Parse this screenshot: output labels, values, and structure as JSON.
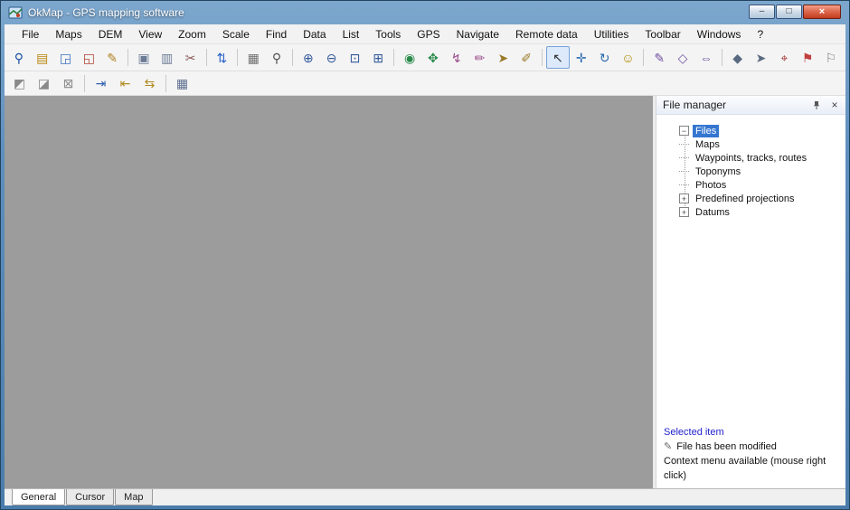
{
  "window": {
    "title": "OkMap - GPS mapping software",
    "controls": {
      "minimize": "–",
      "maximize": "□",
      "close": "×"
    }
  },
  "menu": {
    "items": [
      "File",
      "Maps",
      "DEM",
      "View",
      "Zoom",
      "Scale",
      "Find",
      "Data",
      "List",
      "Tools",
      "GPS",
      "Navigate",
      "Remote data",
      "Utilities",
      "Toolbar",
      "Windows",
      "?"
    ]
  },
  "toolbars": {
    "main": {
      "groups": [
        [
          {
            "name": "zoom-select-icon",
            "glyph": "⚲",
            "color": "#1a50a0"
          },
          {
            "name": "open-map-icon",
            "glyph": "▤",
            "color": "#b8860b"
          },
          {
            "name": "import-map-icon",
            "glyph": "◲",
            "color": "#3a70c0"
          },
          {
            "name": "close-map-icon",
            "glyph": "◱",
            "color": "#b04030"
          },
          {
            "name": "save-map-icon",
            "glyph": "✎",
            "color": "#b08020"
          }
        ],
        [
          {
            "name": "copy-map-icon",
            "glyph": "▣",
            "color": "#6b7b95"
          },
          {
            "name": "duplicate-map-icon",
            "glyph": "▥",
            "color": "#6b7b95"
          },
          {
            "name": "crop-map-icon",
            "glyph": "✂",
            "color": "#8a5a5a"
          }
        ],
        [
          {
            "name": "send-remote-icon",
            "glyph": "⇅",
            "color": "#2a62c8"
          }
        ],
        [
          {
            "name": "map-properties-icon",
            "glyph": "▦",
            "color": "#707070"
          },
          {
            "name": "find-icon",
            "glyph": "⚲",
            "color": "#505050"
          }
        ],
        [
          {
            "name": "zoom-in-icon",
            "glyph": "⊕",
            "color": "#33589a"
          },
          {
            "name": "zoom-out-icon",
            "glyph": "⊖",
            "color": "#33589a"
          },
          {
            "name": "zoom-window-icon",
            "glyph": "⊡",
            "color": "#33589a"
          },
          {
            "name": "zoom-actual-icon",
            "glyph": "⊞",
            "color": "#33589a"
          }
        ],
        [
          {
            "name": "waypoint-new-icon",
            "glyph": "◉",
            "color": "#2a8a4a"
          },
          {
            "name": "waypoint-move-icon",
            "glyph": "✥",
            "color": "#2a8a4a"
          },
          {
            "name": "track-new-icon",
            "glyph": "↯",
            "color": "#9a4a8a"
          },
          {
            "name": "track-edit-icon",
            "glyph": "✏",
            "color": "#9a4a8a"
          },
          {
            "name": "route-new-icon",
            "glyph": "➤",
            "color": "#9a7a2a"
          },
          {
            "name": "route-edit-icon",
            "glyph": "✐",
            "color": "#9a7a2a"
          }
        ],
        [
          {
            "name": "pointer-icon",
            "glyph": "↖",
            "color": "#303030",
            "selected": true
          },
          {
            "name": "pan-icon",
            "glyph": "✛",
            "color": "#2a6ab0"
          },
          {
            "name": "rotate-icon",
            "glyph": "↻",
            "color": "#2a6ab0"
          },
          {
            "name": "smiley-icon",
            "glyph": "☺",
            "color": "#b08a00"
          }
        ],
        [
          {
            "name": "draw-line-icon",
            "glyph": "✎",
            "color": "#7050a0"
          },
          {
            "name": "draw-polygon-icon",
            "glyph": "◇",
            "color": "#7050a0"
          },
          {
            "name": "measure-icon",
            "glyph": "⇔",
            "color": "#7050a0"
          }
        ],
        [
          {
            "name": "vertex-icon",
            "glyph": "◆",
            "color": "#5a6a80"
          },
          {
            "name": "goto-icon",
            "glyph": "➤",
            "color": "#5a6a80"
          },
          {
            "name": "pin-add-icon",
            "glyph": "⌖",
            "color": "#a03030"
          },
          {
            "name": "flag-icon",
            "glyph": "⚑",
            "color": "#c04040"
          },
          {
            "name": "pin-delete-icon",
            "glyph": "⚐",
            "color": "#808080"
          }
        ]
      ]
    },
    "edit": {
      "groups": [
        [
          {
            "name": "eraser-icon",
            "glyph": "◩",
            "color": "#8a8a8a"
          },
          {
            "name": "eraser-region-icon",
            "glyph": "◪",
            "color": "#8a8a8a"
          },
          {
            "name": "eraser-all-icon",
            "glyph": "⊠",
            "color": "#8a8a8a"
          }
        ],
        [
          {
            "name": "import-data-icon",
            "glyph": "⇥",
            "color": "#3060b0"
          },
          {
            "name": "export-data-icon",
            "glyph": "⇤",
            "color": "#b08a20"
          },
          {
            "name": "merge-data-icon",
            "glyph": "⇆",
            "color": "#b08a20"
          }
        ],
        [
          {
            "name": "data-properties-icon",
            "glyph": "▦",
            "color": "#607090"
          }
        ]
      ]
    }
  },
  "file_manager": {
    "title": "File manager",
    "close_glyph": "×",
    "tree": {
      "root": {
        "label": "Files",
        "selected": true,
        "expander": "−"
      },
      "children": [
        {
          "label": "Maps"
        },
        {
          "label": "Waypoints, tracks, routes"
        },
        {
          "label": "Toponyms"
        },
        {
          "label": "Photos"
        },
        {
          "label": "Predefined projections",
          "expander": "+"
        },
        {
          "label": "Datums",
          "expander": "+"
        }
      ]
    },
    "footer": {
      "selected_item_label": "Selected item",
      "modified_icon": "✎",
      "modified_text": "File has been modified",
      "context_text": "Context menu available (mouse right click)"
    }
  },
  "tabs": [
    {
      "label": "General",
      "active": true
    },
    {
      "label": "Cursor",
      "active": false
    },
    {
      "label": "Map",
      "active": false
    }
  ]
}
